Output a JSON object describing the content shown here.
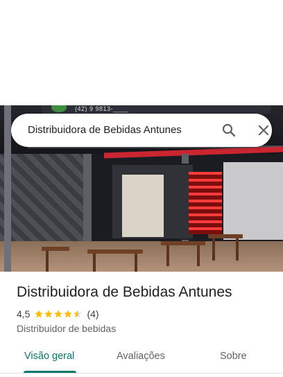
{
  "search": {
    "query": "Distribuidora de Bebidas Antunes"
  },
  "photo": {
    "sign_text": "(42) 9 9813-____"
  },
  "place": {
    "name": "Distribuidora de Bebidas Antunes",
    "rating": "4,5",
    "rating_stars": 4.5,
    "review_count": "(4)",
    "category": "Distribuidor de bebidas"
  },
  "tabs": [
    {
      "label": "Visão geral",
      "active": true
    },
    {
      "label": "Avaliações",
      "active": false
    },
    {
      "label": "Sobre",
      "active": false
    }
  ],
  "colors": {
    "accent": "#00796b",
    "star": "#fbbc04",
    "text": "#202124",
    "secondary": "#5f6368"
  },
  "icons": {
    "search": "search-icon",
    "close": "close-icon",
    "star": "star-icon"
  }
}
